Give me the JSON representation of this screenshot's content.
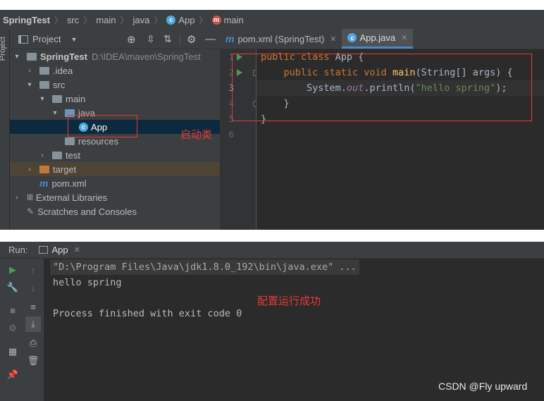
{
  "breadcrumb": {
    "items": [
      "SpringTest",
      "src",
      "main",
      "java",
      "App",
      "main"
    ]
  },
  "left_stripe": {
    "label": "Project"
  },
  "project_panel": {
    "title": "Project",
    "tree": [
      {
        "label": "SpringTest",
        "path": "D:\\IDEA\\maven\\SpringTest"
      },
      {
        "label": ".idea"
      },
      {
        "label": "src"
      },
      {
        "label": "main"
      },
      {
        "label": "java"
      },
      {
        "label": "App"
      },
      {
        "label": "resources"
      },
      {
        "label": "test"
      },
      {
        "label": "target"
      },
      {
        "label": "pom.xml"
      },
      {
        "label": "External Libraries"
      },
      {
        "label": "Scratches and Consoles"
      }
    ]
  },
  "editor": {
    "tabs": [
      {
        "label": "pom.xml (SpringTest)",
        "active": false
      },
      {
        "label": "App.java",
        "active": true
      }
    ],
    "line_numbers": [
      "1",
      "2",
      "3",
      "4",
      "5",
      "6"
    ],
    "code": {
      "l1_kw": "public class ",
      "l1_name": "App {",
      "l2_kw": "    public static void ",
      "l2_fn": "main",
      "l2_rest": "(String[] args) {",
      "l3_a": "        System.",
      "l3_out": "out",
      "l3_b": ".println(",
      "l3_str": "\"hello spring\"",
      "l3_c": ");",
      "l4": "    }",
      "l5": "}"
    }
  },
  "annotations": {
    "startup_class": "启动类",
    "run_success": "配置运行成功"
  },
  "run_panel": {
    "label": "Run:",
    "tab": "App",
    "console": [
      "\"D:\\Program Files\\Java\\jdk1.8.0_192\\bin\\java.exe\" ...",
      "hello spring",
      "",
      "Process finished with exit code 0"
    ]
  },
  "watermark": "CSDN @Fly upward",
  "colors": {
    "ide_panel": "#3c3f41",
    "editor_bg": "#2b2b2b",
    "keyword": "#cc7832",
    "function": "#ffc66d",
    "string": "#6a8759",
    "annotation_red": "#e53935",
    "selection": "#0d293e"
  }
}
